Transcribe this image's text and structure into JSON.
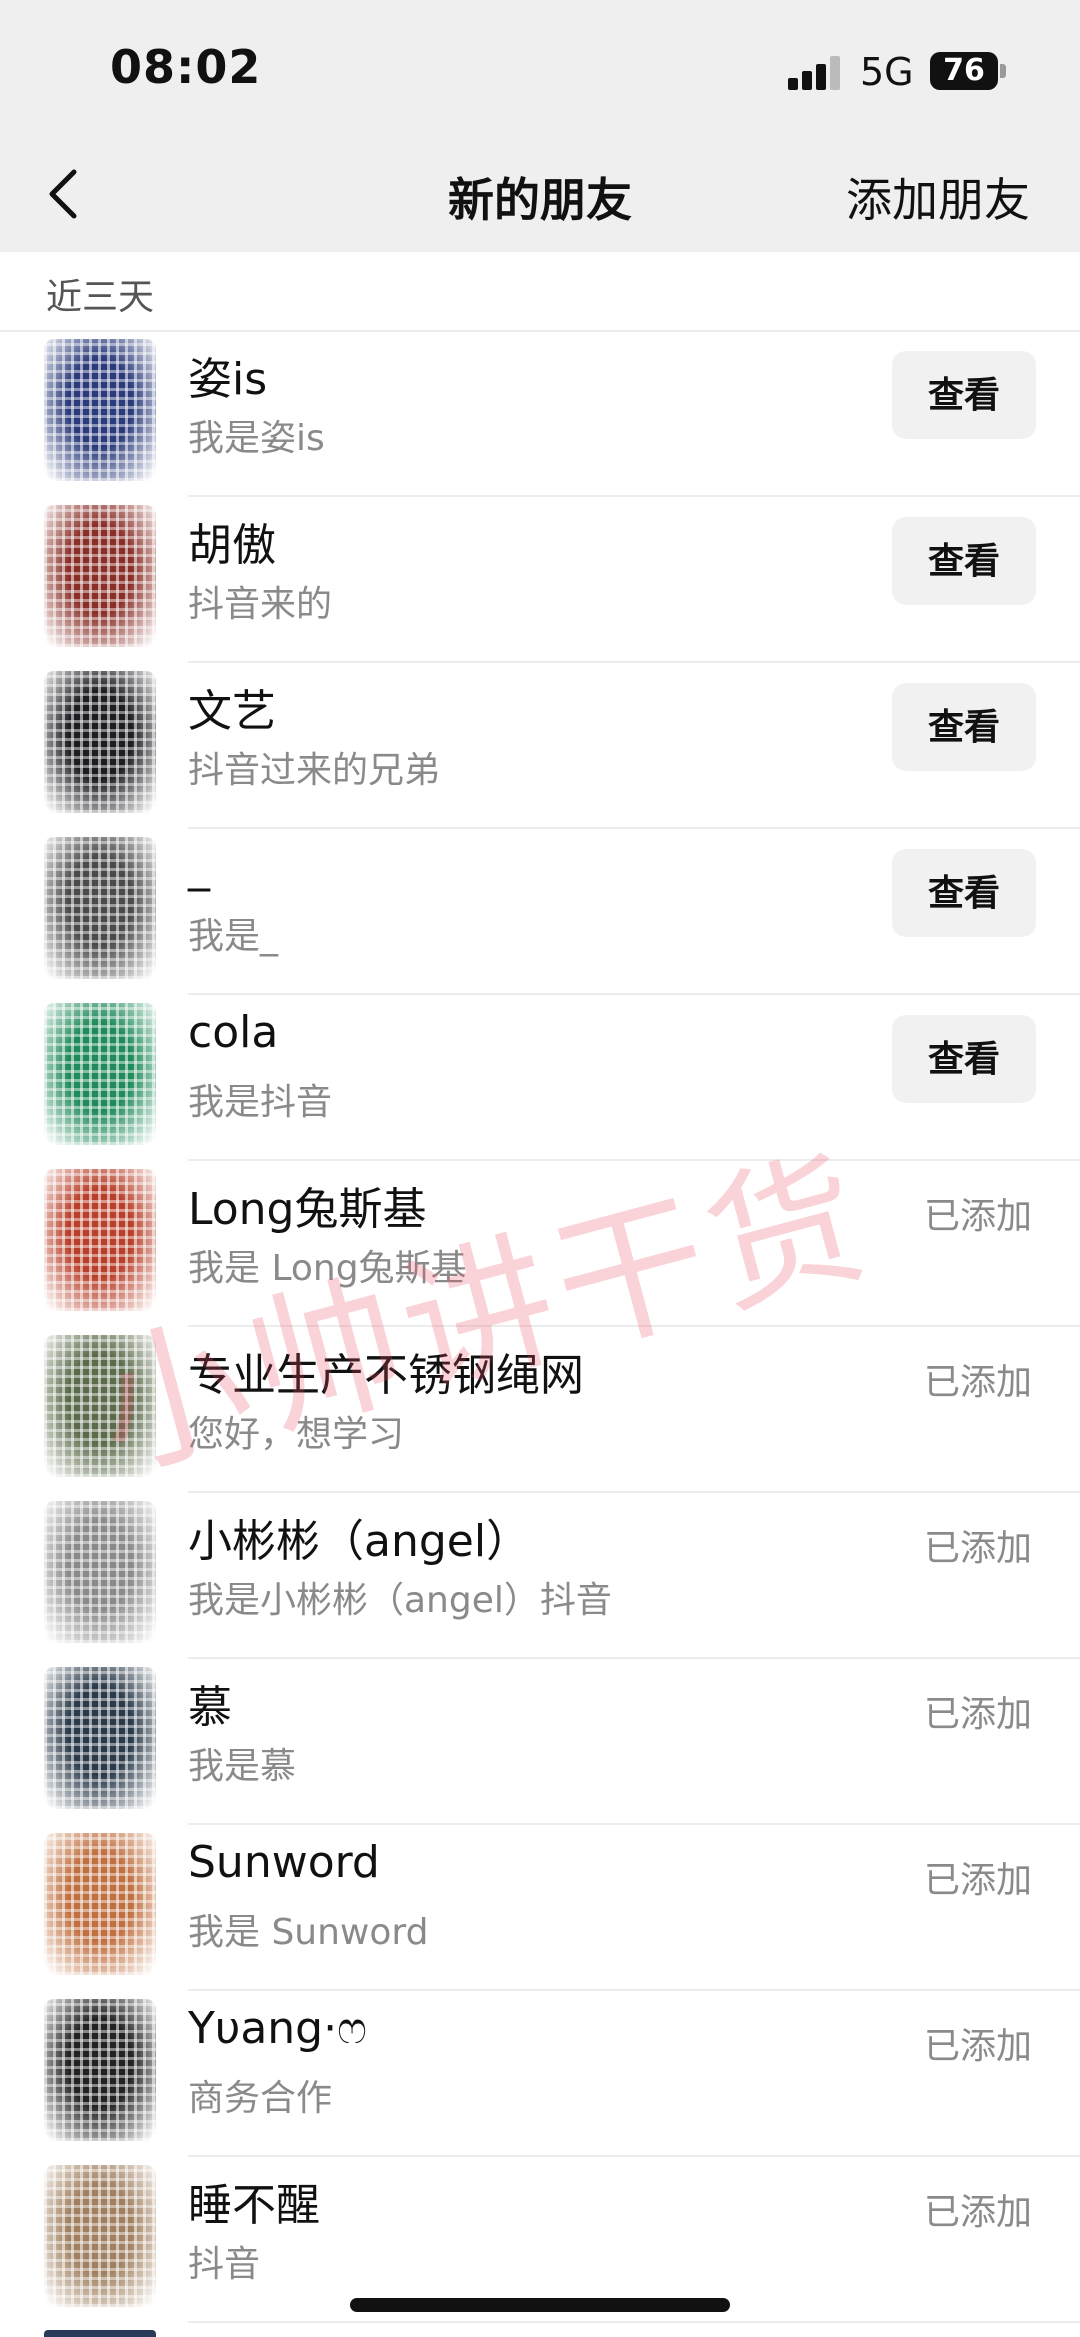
{
  "status_bar": {
    "time": "08:02",
    "network": "5G",
    "battery": "76"
  },
  "nav": {
    "title": "新的朋友",
    "action": "添加朋友"
  },
  "section": {
    "label": "近三天"
  },
  "watermark": "小帅讲干货",
  "view_label": "查看",
  "added_label": "已添加",
  "friends": [
    {
      "name": "姿is",
      "message": "我是姿is",
      "status": "view",
      "avatar_color": "#2a3a7a"
    },
    {
      "name": "胡傲",
      "message": "抖音来的",
      "status": "view",
      "avatar_color": "#8a2f28"
    },
    {
      "name": "文艺",
      "message": "抖音过来的兄弟",
      "status": "view",
      "avatar_color": "#1c1c22"
    },
    {
      "name": "_",
      "message": "我是_",
      "status": "view",
      "avatar_color": "#4a4a4a"
    },
    {
      "name": "cola",
      "message": "我是抖音",
      "status": "view",
      "avatar_color": "#1f8a5a"
    },
    {
      "name": "Long兔斯基",
      "message": "我是 Long兔斯基",
      "status": "added",
      "avatar_color": "#b8402a"
    },
    {
      "name": "专业生产不锈钢绳网",
      "message": "您好，想学习",
      "status": "added",
      "avatar_color": "#5a6a4a"
    },
    {
      "name": "小彬彬（angel）",
      "message": "我是小彬彬（angel）抖音",
      "status": "added",
      "avatar_color": "#8a8a8a"
    },
    {
      "name": "慕",
      "message": "我是慕",
      "status": "added",
      "avatar_color": "#2a3a4a"
    },
    {
      "name": "Sunword",
      "message": "我是 Sunword",
      "status": "added",
      "avatar_color": "#c07040"
    },
    {
      "name": "Yυang·ෆ",
      "message": "商务合作",
      "status": "added",
      "avatar_color": "#222222"
    },
    {
      "name": "睡不醒",
      "message": "抖音",
      "status": "added",
      "avatar_color": "#a08060"
    }
  ]
}
